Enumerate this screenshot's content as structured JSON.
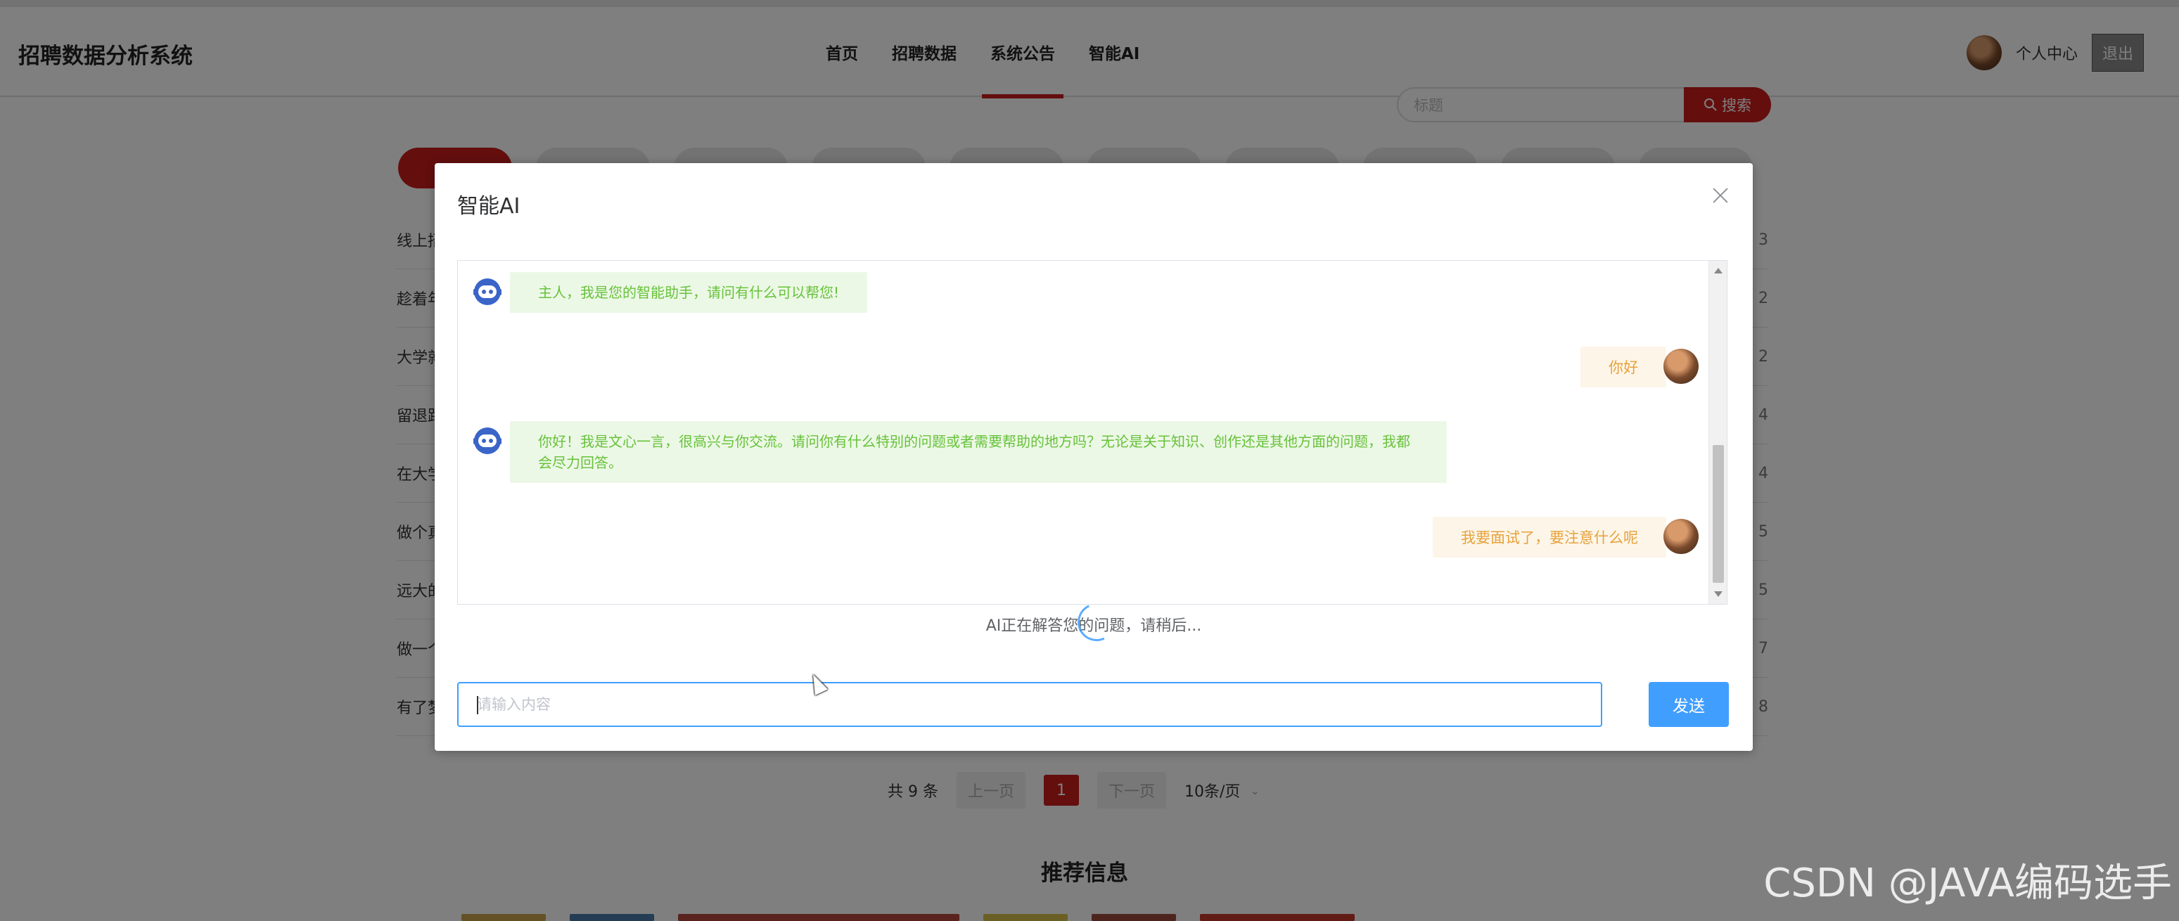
{
  "header": {
    "brand": "招聘数据分析系统",
    "nav": [
      {
        "label": "首页",
        "active": false
      },
      {
        "label": "招聘数据",
        "active": false
      },
      {
        "label": "系统公告",
        "active": true
      },
      {
        "label": "智能AI",
        "active": false
      }
    ],
    "user_center": "个人中心",
    "logout": "退出"
  },
  "search": {
    "placeholder": "标题",
    "button": "搜索",
    "icon": "search-icon"
  },
  "list": {
    "rows": [
      {
        "title": "线上招",
        "num": "3"
      },
      {
        "title": "趁着年",
        "num": "2"
      },
      {
        "title": "大学就",
        "num": "2"
      },
      {
        "title": "留退路",
        "num": "4"
      },
      {
        "title": "在大学",
        "num": "4"
      },
      {
        "title": "做个真",
        "num": "5"
      },
      {
        "title": "远大的",
        "num": "5"
      },
      {
        "title": "做一个",
        "num": "7"
      },
      {
        "title": "有了梦",
        "num": "8"
      }
    ]
  },
  "pager": {
    "total": "共 9 条",
    "prev": "上一页",
    "current": "1",
    "next": "下一页",
    "page_size": "10条/页"
  },
  "recommend_title": "推荐信息",
  "modal": {
    "title": "智能AI",
    "messages": {
      "ai1": "主人，我是您的智能助手，请问有什么可以帮您!",
      "user1": "你好",
      "ai2": "你好！我是文心一言，很高兴与你交流。请问你有什么特别的问题或者需要帮助的地方吗？无论是关于知识、创作还是其他方面的问题，我都会尽力回答。",
      "user2": "我要面试了，要注意什么呢"
    },
    "status": "AI正在解答您的问题，请稍后...",
    "input_placeholder": "请输入内容",
    "send": "发送"
  },
  "colors": {
    "brand_red": "#c81d1d",
    "primary_blue": "#409eff",
    "ai_bubble_bg": "#ecf8e6",
    "ai_text": "#67c23a",
    "user_bubble_bg": "#fdf5e8",
    "user_text": "#e6a23c"
  },
  "watermark": "CSDN @JAVA编码选手"
}
